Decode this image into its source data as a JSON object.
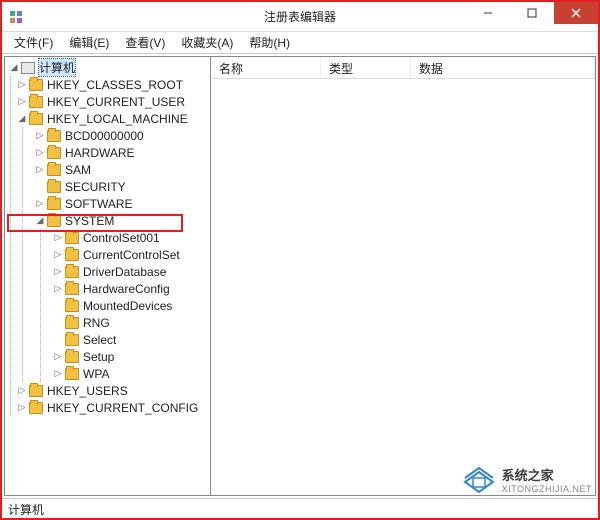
{
  "window": {
    "title": "注册表编辑器"
  },
  "menu": {
    "file": "文件(F)",
    "edit": "编辑(E)",
    "view": "查看(V)",
    "favorites": "收藏夹(A)",
    "help": "帮助(H)"
  },
  "list_headers": {
    "name": "名称",
    "type": "类型",
    "data": "数据"
  },
  "tree": {
    "root": "计算机",
    "hives": {
      "hkcr": "HKEY_CLASSES_ROOT",
      "hkcu": "HKEY_CURRENT_USER",
      "hklm": "HKEY_LOCAL_MACHINE",
      "hku": "HKEY_USERS",
      "hkcc": "HKEY_CURRENT_CONFIG"
    },
    "hklm_children": {
      "bcd": "BCD00000000",
      "hardware": "HARDWARE",
      "sam": "SAM",
      "security": "SECURITY",
      "software": "SOFTWARE",
      "system": "SYSTEM"
    },
    "system_children": {
      "ccs001": "ControlSet001",
      "ccs": "CurrentControlSet",
      "driverdb": "DriverDatabase",
      "hwcfg": "HardwareConfig",
      "mounted": "MountedDevices",
      "rng": "RNG",
      "select": "Select",
      "setup": "Setup",
      "wpa": "WPA"
    }
  },
  "statusbar": {
    "path": "计算机"
  },
  "watermark": {
    "brand": "系统之家",
    "url": "XITONGZHIJIA.NET"
  }
}
